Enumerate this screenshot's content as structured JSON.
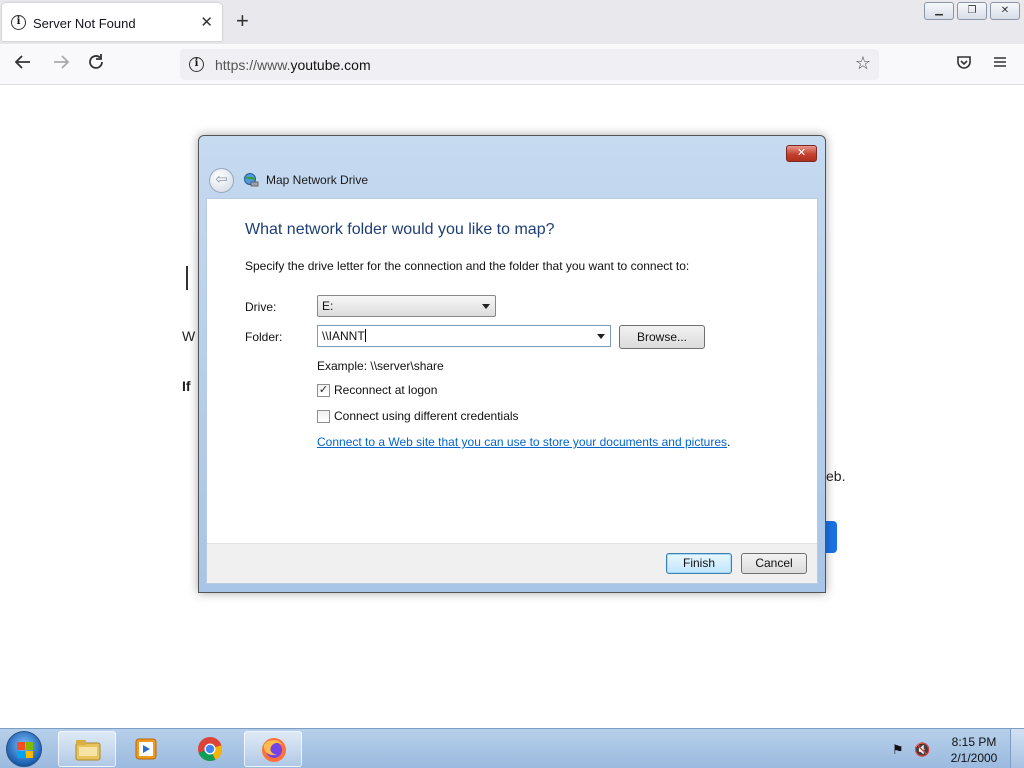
{
  "browser": {
    "tab_title": "Server Not Found",
    "tab_close": "✕",
    "new_tab": "+",
    "url_prefix": "https://www.",
    "url_domain": "youtube.com",
    "window_buttons": {
      "minimize": "▁",
      "restore": "❐",
      "close": "✕"
    }
  },
  "page_fragments": {
    "left_w": "W",
    "left_if": "If",
    "right_eb": "eb."
  },
  "dialog": {
    "title": "Map Network Drive",
    "close": "✕",
    "heading": "What network folder would you like to map?",
    "instruction": "Specify the drive letter for the connection and the folder that you want to connect to:",
    "drive_label": "Drive:",
    "drive_value": "E:",
    "folder_label": "Folder:",
    "folder_value": "\\\\IANNT",
    "browse_label": "Browse...",
    "example": "Example: \\\\server\\share",
    "reconnect_label": "Reconnect at logon",
    "reconnect_checked": true,
    "credentials_label": "Connect using different credentials",
    "credentials_checked": false,
    "web_link": "Connect to a Web site that you can use to store your documents and pictures",
    "finish_label": "Finish",
    "cancel_label": "Cancel"
  },
  "taskbar": {
    "time": "8:15 PM",
    "date": "2/1/2000",
    "items": [
      "explorer",
      "media-player",
      "chrome",
      "firefox"
    ]
  },
  "colors": {
    "dialog_heading": "#1e3f75",
    "link": "#0066cc",
    "page_button_blue": "#1a73e8"
  }
}
